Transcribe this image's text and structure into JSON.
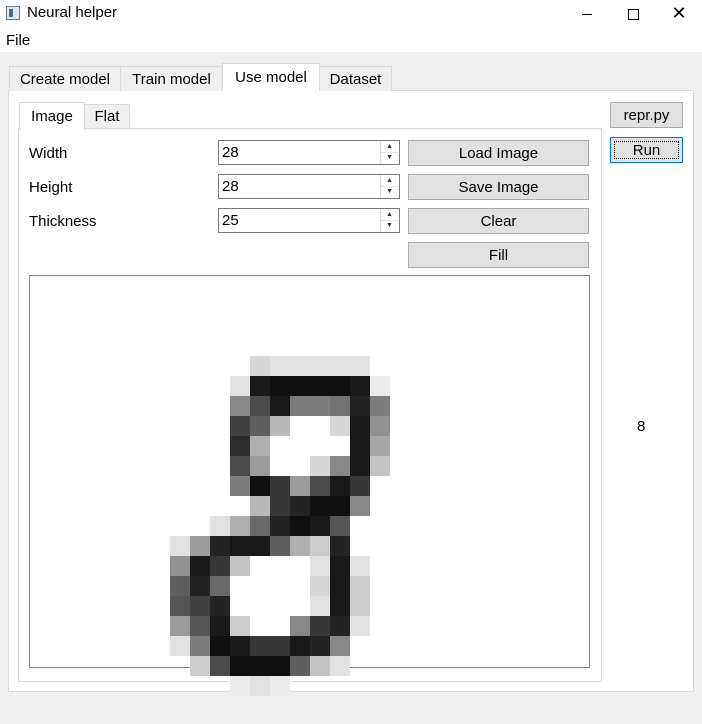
{
  "window": {
    "title": "Neural helper",
    "minimize": "–",
    "maximize": "□",
    "close": "✕"
  },
  "menu": {
    "file": "File"
  },
  "tabs": [
    "Create model",
    "Train model",
    "Use model",
    "Dataset"
  ],
  "subtabs": [
    "Image",
    "Flat"
  ],
  "fields": {
    "width": {
      "label": "Width",
      "value": "28"
    },
    "height": {
      "label": "Height",
      "value": "28"
    },
    "thickness": {
      "label": "Thickness",
      "value": "25"
    }
  },
  "buttons": {
    "load": "Load Image",
    "save": "Save Image",
    "clear": "Clear",
    "fill": "Fill",
    "repr": "repr.py",
    "run": "Run"
  },
  "prediction": "8",
  "drawing": {
    "description_rows": 28,
    "pixels": [
      [
        12,
        8,
        40
      ],
      [
        13,
        8,
        30
      ],
      [
        14,
        8,
        30
      ],
      [
        15,
        8,
        30
      ],
      [
        16,
        8,
        30
      ],
      [
        17,
        8,
        30
      ],
      [
        11,
        9,
        30
      ],
      [
        12,
        9,
        230
      ],
      [
        13,
        9,
        240
      ],
      [
        14,
        9,
        240
      ],
      [
        15,
        9,
        240
      ],
      [
        16,
        9,
        240
      ],
      [
        17,
        9,
        230
      ],
      [
        18,
        9,
        20
      ],
      [
        11,
        10,
        120
      ],
      [
        12,
        10,
        180
      ],
      [
        13,
        10,
        230
      ],
      [
        14,
        10,
        130
      ],
      [
        15,
        10,
        130
      ],
      [
        16,
        10,
        140
      ],
      [
        17,
        10,
        220
      ],
      [
        18,
        10,
        130
      ],
      [
        11,
        11,
        190
      ],
      [
        12,
        11,
        160
      ],
      [
        13,
        11,
        70
      ],
      [
        16,
        11,
        40
      ],
      [
        17,
        11,
        230
      ],
      [
        18,
        11,
        110
      ],
      [
        11,
        12,
        210
      ],
      [
        12,
        12,
        80
      ],
      [
        17,
        12,
        230
      ],
      [
        18,
        12,
        90
      ],
      [
        11,
        13,
        180
      ],
      [
        12,
        13,
        100
      ],
      [
        15,
        13,
        40
      ],
      [
        16,
        13,
        120
      ],
      [
        17,
        13,
        230
      ],
      [
        18,
        13,
        60
      ],
      [
        11,
        14,
        130
      ],
      [
        12,
        14,
        240
      ],
      [
        13,
        14,
        200
      ],
      [
        14,
        14,
        100
      ],
      [
        15,
        14,
        180
      ],
      [
        16,
        14,
        230
      ],
      [
        17,
        14,
        200
      ],
      [
        12,
        15,
        70
      ],
      [
        13,
        15,
        200
      ],
      [
        14,
        15,
        220
      ],
      [
        15,
        15,
        240
      ],
      [
        16,
        15,
        240
      ],
      [
        17,
        15,
        120
      ],
      [
        10,
        16,
        30
      ],
      [
        11,
        16,
        80
      ],
      [
        12,
        16,
        150
      ],
      [
        13,
        16,
        220
      ],
      [
        14,
        16,
        240
      ],
      [
        15,
        16,
        230
      ],
      [
        16,
        16,
        170
      ],
      [
        8,
        17,
        30
      ],
      [
        9,
        17,
        100
      ],
      [
        10,
        17,
        220
      ],
      [
        11,
        17,
        230
      ],
      [
        12,
        17,
        230
      ],
      [
        13,
        17,
        160
      ],
      [
        14,
        17,
        80
      ],
      [
        15,
        17,
        50
      ],
      [
        16,
        17,
        220
      ],
      [
        8,
        18,
        110
      ],
      [
        9,
        18,
        230
      ],
      [
        10,
        18,
        200
      ],
      [
        11,
        18,
        60
      ],
      [
        15,
        18,
        30
      ],
      [
        16,
        18,
        230
      ],
      [
        17,
        18,
        30
      ],
      [
        8,
        19,
        160
      ],
      [
        9,
        19,
        220
      ],
      [
        10,
        19,
        150
      ],
      [
        15,
        19,
        40
      ],
      [
        16,
        19,
        230
      ],
      [
        17,
        19,
        50
      ],
      [
        8,
        20,
        170
      ],
      [
        9,
        20,
        190
      ],
      [
        10,
        20,
        220
      ],
      [
        15,
        20,
        30
      ],
      [
        16,
        20,
        230
      ],
      [
        17,
        20,
        50
      ],
      [
        8,
        21,
        100
      ],
      [
        9,
        21,
        170
      ],
      [
        10,
        21,
        230
      ],
      [
        11,
        21,
        50
      ],
      [
        14,
        21,
        120
      ],
      [
        15,
        21,
        200
      ],
      [
        16,
        21,
        220
      ],
      [
        17,
        21,
        30
      ],
      [
        8,
        22,
        30
      ],
      [
        9,
        22,
        130
      ],
      [
        10,
        22,
        240
      ],
      [
        11,
        22,
        230
      ],
      [
        12,
        22,
        200
      ],
      [
        13,
        22,
        200
      ],
      [
        14,
        22,
        230
      ],
      [
        15,
        22,
        220
      ],
      [
        16,
        22,
        120
      ],
      [
        9,
        23,
        50
      ],
      [
        10,
        23,
        180
      ],
      [
        11,
        23,
        240
      ],
      [
        12,
        23,
        240
      ],
      [
        13,
        23,
        240
      ],
      [
        14,
        23,
        160
      ],
      [
        15,
        23,
        60
      ],
      [
        16,
        23,
        30
      ],
      [
        11,
        24,
        20
      ],
      [
        12,
        24,
        30
      ],
      [
        13,
        24,
        20
      ]
    ]
  }
}
